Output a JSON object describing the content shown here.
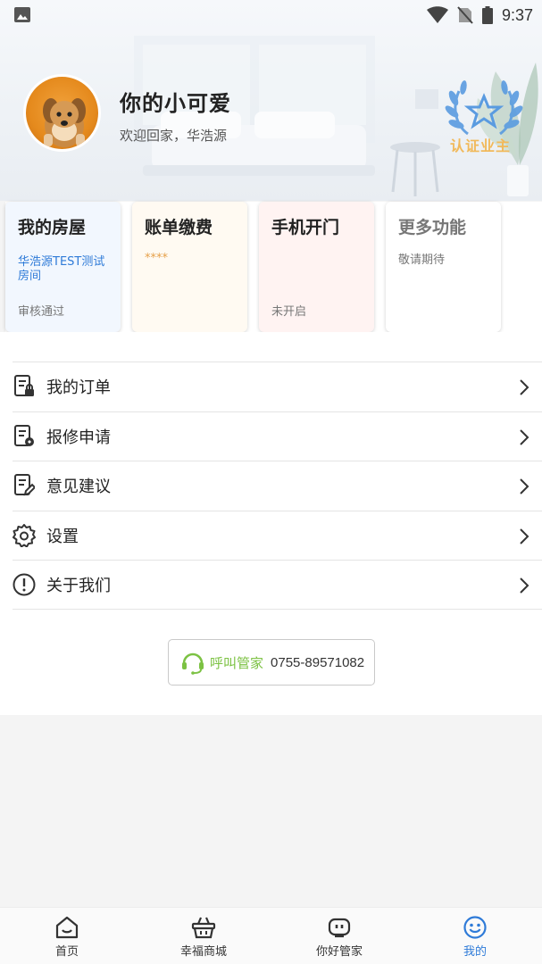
{
  "status_bar": {
    "time": "9:37"
  },
  "profile": {
    "name": "你的小可爱",
    "welcome": "欢迎回家，华浩源",
    "badge_label": "认证业主"
  },
  "cards": [
    {
      "title": "我的房屋",
      "sub": "华浩源TEST测试房间",
      "foot": "审核通过"
    },
    {
      "title": "账单缴费",
      "sub": "****",
      "foot": ""
    },
    {
      "title": "手机开门",
      "sub": "",
      "foot": "未开启"
    },
    {
      "title": "更多功能",
      "sub": "敬请期待",
      "foot": ""
    }
  ],
  "menu": [
    {
      "label": "我的订单",
      "icon": "order-icon"
    },
    {
      "label": "报修申请",
      "icon": "repair-icon"
    },
    {
      "label": "意见建议",
      "icon": "feedback-icon"
    },
    {
      "label": "设置",
      "icon": "gear-icon"
    },
    {
      "label": "关于我们",
      "icon": "info-icon"
    }
  ],
  "call": {
    "label": "呼叫管家",
    "phone": "0755-89571082"
  },
  "tabs": [
    {
      "label": "首页",
      "icon": "home-icon"
    },
    {
      "label": "幸福商城",
      "icon": "basket-icon"
    },
    {
      "label": "你好管家",
      "icon": "robot-icon"
    },
    {
      "label": "我的",
      "icon": "smile-icon",
      "active": true
    }
  ],
  "colors": {
    "accent_blue": "#2f7bd8",
    "call_green": "#7cc243",
    "badge_gold": "#f1b95a"
  }
}
